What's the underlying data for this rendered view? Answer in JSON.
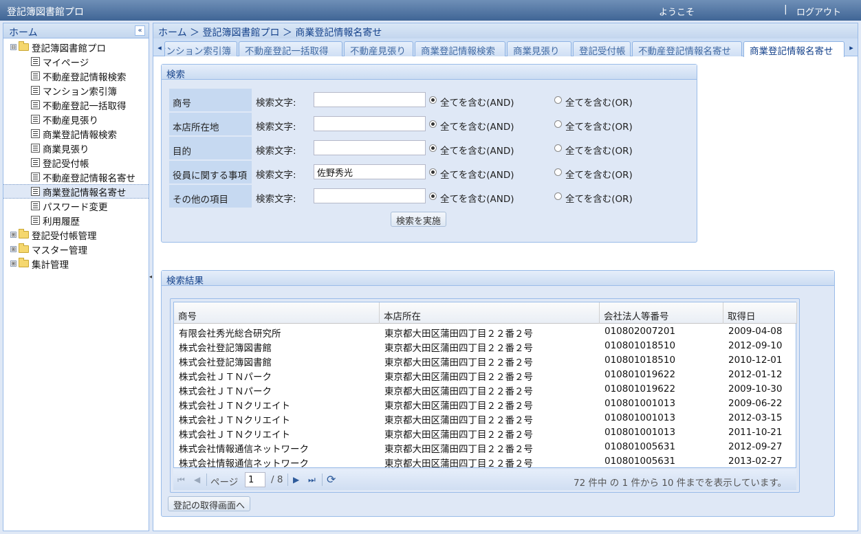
{
  "header": {
    "app_title": "登記簿図書館プロ",
    "welcome": "ようこそ",
    "separator": "|",
    "logout": "ログアウト"
  },
  "sidebar": {
    "title": "ホーム",
    "collapse_icon": "«",
    "root": {
      "label": "登記簿図書館プロ",
      "expander": "⊟"
    },
    "items": [
      {
        "label": "マイページ"
      },
      {
        "label": "不動産登記情報検索"
      },
      {
        "label": "マンション索引簿"
      },
      {
        "label": "不動産登記一括取得"
      },
      {
        "label": "不動産見張り"
      },
      {
        "label": "商業登記情報検索"
      },
      {
        "label": "商業見張り"
      },
      {
        "label": "登記受付帳"
      },
      {
        "label": "不動産登記情報名寄せ"
      },
      {
        "label": "商業登記情報名寄せ"
      },
      {
        "label": "パスワード変更"
      },
      {
        "label": "利用履歴"
      }
    ],
    "selected_index": 9,
    "folders": [
      {
        "label": "登記受付帳管理",
        "expander": "⊞"
      },
      {
        "label": "マスター管理",
        "expander": "⊞"
      },
      {
        "label": "集計管理",
        "expander": "⊞"
      }
    ]
  },
  "splitter_icon": "◂",
  "breadcrumb": "ホーム ＞ 登記簿図書館プロ ＞ 商業登記情報名寄せ",
  "tabs": {
    "scroll_left": "◂",
    "scroll_right": "▸",
    "items": [
      {
        "label": "マンション索引簿"
      },
      {
        "label": "不動産登記一括取得"
      },
      {
        "label": "不動産見張り"
      },
      {
        "label": "商業登記情報検索"
      },
      {
        "label": "商業見張り"
      },
      {
        "label": "登記受付帳"
      },
      {
        "label": "不動産登記情報名寄せ"
      },
      {
        "label": "商業登記情報名寄せ"
      }
    ],
    "active_index": 7
  },
  "search": {
    "title": "検索",
    "keyword_label": "検索文字:",
    "and_label": "全てを含む(AND)",
    "or_label": "全てを含む(OR)",
    "rows": [
      {
        "label": "商号",
        "value": "",
        "mode": "AND"
      },
      {
        "label": "本店所在地",
        "value": "",
        "mode": "AND"
      },
      {
        "label": "目的",
        "value": "",
        "mode": "AND"
      },
      {
        "label": "役員に関する事項",
        "value": "佐野秀光",
        "mode": "AND"
      },
      {
        "label": "その他の項目",
        "value": "",
        "mode": "AND"
      }
    ],
    "submit_label": "検索を実施"
  },
  "results": {
    "title": "検索結果",
    "columns": [
      "商号",
      "本店所在",
      "会社法人等番号",
      "取得日"
    ],
    "rows": [
      [
        "有限会社秀光総合研究所",
        "東京都大田区蒲田四丁目２２番２号",
        "010802007201",
        "2009-04-08"
      ],
      [
        "株式会社登記簿図書館",
        "東京都大田区蒲田四丁目２２番２号",
        "010801018510",
        "2012-09-10"
      ],
      [
        "株式会社登記簿図書館",
        "東京都大田区蒲田四丁目２２番２号",
        "010801018510",
        "2010-12-01"
      ],
      [
        "株式会社ＪＴＮパーク",
        "東京都大田区蒲田四丁目２２番２号",
        "010801019622",
        "2012-01-12"
      ],
      [
        "株式会社ＪＴＮパーク",
        "東京都大田区蒲田四丁目２２番２号",
        "010801019622",
        "2009-10-30"
      ],
      [
        "株式会社ＪＴＮクリエイト",
        "東京都大田区蒲田四丁目２２番２号",
        "010801001013",
        "2009-06-22"
      ],
      [
        "株式会社ＪＴＮクリエイト",
        "東京都大田区蒲田四丁目２２番２号",
        "010801001013",
        "2012-03-15"
      ],
      [
        "株式会社ＪＴＮクリエイト",
        "東京都大田区蒲田四丁目２２番２号",
        "010801001013",
        "2011-10-21"
      ],
      [
        "株式会社情報通信ネットワーク",
        "東京都大田区蒲田四丁目２２番２号",
        "010801005631",
        "2012-09-27"
      ],
      [
        "株式会社情報通信ネットワーク",
        "東京都大田区蒲田四丁目２２番２号",
        "010801005631",
        "2013-02-27"
      ]
    ],
    "pager": {
      "first_icon": "⏮",
      "prev_icon": "◀",
      "page_label": "ページ",
      "page_value": "1",
      "total_pages": "/ 8",
      "next_icon": "▶",
      "last_icon": "⏭",
      "refresh_icon": "⟳",
      "summary": "72 件中 の 1 件から 10 件までを表示しています。"
    },
    "goto_button": "登記の取得画面へ"
  }
}
